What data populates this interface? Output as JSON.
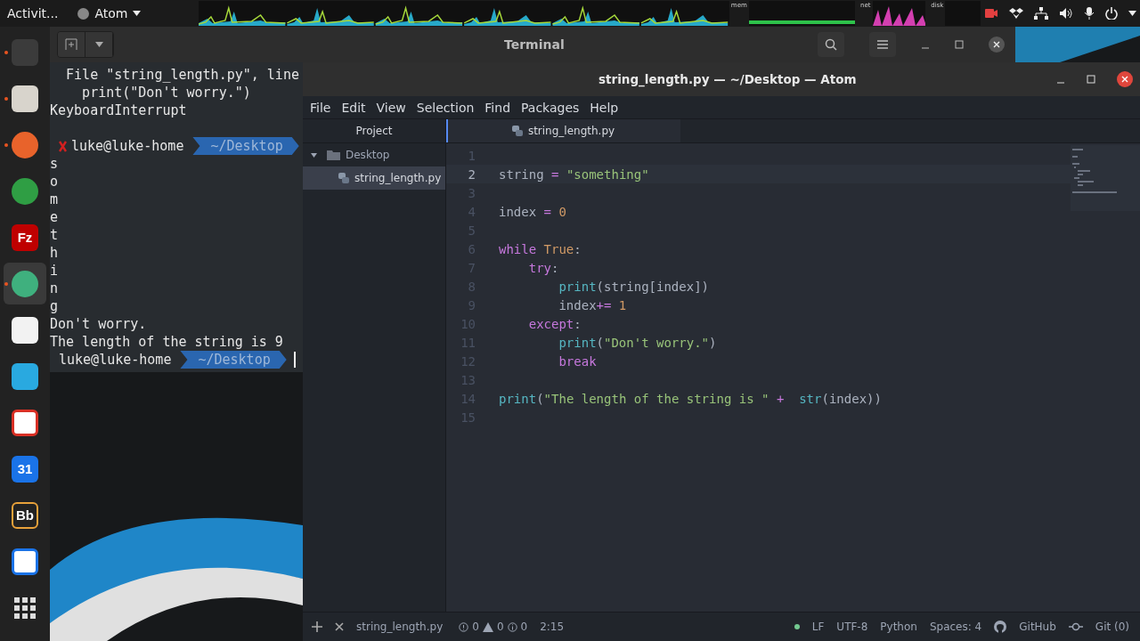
{
  "top_bar": {
    "activities": "Activit...",
    "app_menu": "Atom",
    "monitors": [
      "mem",
      "net",
      "disk"
    ]
  },
  "dock": [
    {
      "kind": "terminal",
      "running": true,
      "selected": false
    },
    {
      "kind": "files",
      "running": true,
      "selected": false
    },
    {
      "kind": "firefox",
      "running": true,
      "selected": false
    },
    {
      "kind": "chrome",
      "running": false,
      "selected": false
    },
    {
      "kind": "filezilla",
      "label": "Fz",
      "running": false,
      "selected": false
    },
    {
      "kind": "atom",
      "running": true,
      "selected": true
    },
    {
      "kind": "editor",
      "running": false,
      "selected": false
    },
    {
      "kind": "mail",
      "running": false,
      "selected": false
    },
    {
      "kind": "gmail",
      "running": false,
      "selected": false
    },
    {
      "kind": "calendar",
      "label": "31",
      "running": false,
      "selected": false
    },
    {
      "kind": "bb",
      "label": "Bb",
      "running": false,
      "selected": false
    },
    {
      "kind": "pinta",
      "running": false,
      "selected": false
    },
    {
      "kind": "apps",
      "running": false,
      "selected": false
    }
  ],
  "terminal": {
    "title": "Terminal",
    "lines": [
      {
        "kind": "text",
        "text": "  File \"string_length.py\", line"
      },
      {
        "kind": "text",
        "text": "    print(\"Don't worry.\")"
      },
      {
        "kind": "text",
        "text": "KeyboardInterrupt"
      },
      {
        "kind": "blank"
      },
      {
        "kind": "prompt",
        "error": true,
        "user": "luke@luke-home",
        "path": "~/Desktop",
        "cursor": false
      },
      {
        "kind": "text",
        "text": "s"
      },
      {
        "kind": "text",
        "text": "o"
      },
      {
        "kind": "text",
        "text": "m"
      },
      {
        "kind": "text",
        "text": "e"
      },
      {
        "kind": "text",
        "text": "t"
      },
      {
        "kind": "text",
        "text": "h"
      },
      {
        "kind": "text",
        "text": "i"
      },
      {
        "kind": "text",
        "text": "n"
      },
      {
        "kind": "text",
        "text": "g"
      },
      {
        "kind": "text",
        "text": "Don't worry."
      },
      {
        "kind": "text",
        "text": "The length of the string is 9"
      },
      {
        "kind": "prompt",
        "error": false,
        "user": "luke@luke-home",
        "path": "~/Desktop",
        "cursor": true
      }
    ]
  },
  "atom": {
    "title": "string_length.py — ~/Desktop — Atom",
    "menu": [
      "File",
      "Edit",
      "View",
      "Selection",
      "Find",
      "Packages",
      "Help"
    ],
    "tree": {
      "header": "Project",
      "folder": {
        "name": "Desktop",
        "expanded": true,
        "children": [
          {
            "name": "string_length.py",
            "selected": true
          }
        ]
      }
    },
    "tabs": [
      {
        "label": "string_length.py",
        "selected": true
      }
    ],
    "code": [
      {
        "number": "1",
        "current": false
      },
      {
        "number": "2",
        "current": true,
        "tokens": [
          {
            "kind": "plain",
            "text": "string "
          },
          {
            "kind": "op",
            "text": "="
          },
          {
            "kind": "str",
            "text": " \"something\""
          }
        ]
      },
      {
        "number": "3",
        "current": false
      },
      {
        "number": "4",
        "current": false,
        "tokens": [
          {
            "kind": "plain",
            "text": "index "
          },
          {
            "kind": "op",
            "text": "="
          },
          {
            "kind": "num",
            "text": " 0"
          }
        ]
      },
      {
        "number": "5",
        "current": false
      },
      {
        "number": "6",
        "current": false,
        "tokens": [
          {
            "kind": "kw",
            "text": "while"
          },
          {
            "kind": "num",
            "text": " True"
          },
          {
            "kind": "plain",
            "text": ":"
          }
        ]
      },
      {
        "number": "7",
        "current": false,
        "tokens": [
          {
            "kind": "kw",
            "text": "    try"
          },
          {
            "kind": "plain",
            "text": ":"
          }
        ]
      },
      {
        "number": "8",
        "current": false,
        "tokens": [
          {
            "kind": "fn",
            "text": "        print"
          },
          {
            "kind": "plain",
            "text": "(string[index])"
          }
        ]
      },
      {
        "number": "9",
        "current": false,
        "tokens": [
          {
            "kind": "plain",
            "text": "        index"
          },
          {
            "kind": "op",
            "text": "+="
          },
          {
            "kind": "num",
            "text": " 1"
          }
        ]
      },
      {
        "number": "10",
        "current": false,
        "tokens": [
          {
            "kind": "kw",
            "text": "    except"
          },
          {
            "kind": "plain",
            "text": ":"
          }
        ]
      },
      {
        "number": "11",
        "current": false,
        "tokens": [
          {
            "kind": "fn",
            "text": "        print"
          },
          {
            "kind": "plain",
            "text": "("
          },
          {
            "kind": "str",
            "text": "\"Don't worry.\""
          },
          {
            "kind": "plain",
            "text": ")"
          }
        ]
      },
      {
        "number": "12",
        "current": false,
        "tokens": [
          {
            "kind": "kw",
            "text": "        break"
          }
        ]
      },
      {
        "number": "13",
        "current": false
      },
      {
        "number": "14",
        "current": false,
        "tokens": [
          {
            "kind": "fn",
            "text": "print"
          },
          {
            "kind": "plain",
            "text": "("
          },
          {
            "kind": "str",
            "text": "\"The length of the string is \""
          },
          {
            "kind": "op",
            "text": " +"
          },
          {
            "kind": "fn",
            "text": "  str"
          },
          {
            "kind": "plain",
            "text": "(index))"
          }
        ]
      },
      {
        "number": "15",
        "current": false
      }
    ],
    "status": {
      "file": "string_length.py",
      "errors": "0",
      "warnings": "0",
      "infos": "0",
      "position": "2:15",
      "line_ending": "LF",
      "encoding": "UTF-8",
      "grammar": "Python",
      "indent": "Spaces: 4",
      "github": "GitHub",
      "git": "Git (0)"
    }
  }
}
